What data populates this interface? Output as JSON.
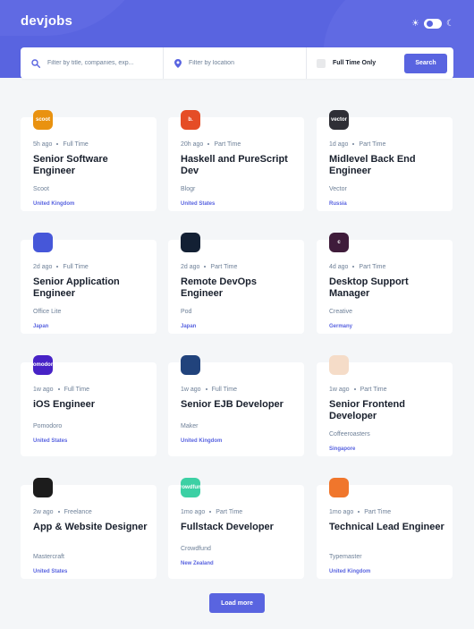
{
  "app": {
    "logo": "devjobs"
  },
  "theme": {
    "sun_icon": "sun-icon",
    "moon_icon": "moon-icon",
    "mode": "light"
  },
  "filters": {
    "title_placeholder": "Filter by title, companies, exp...",
    "location_placeholder": "Filter by location",
    "full_time_label": "Full Time Only",
    "search_label": "Search"
  },
  "colors": {
    "accent": "#5964e0",
    "background": "#f4f6f8",
    "text": "#19202d",
    "muted": "#6e8098"
  },
  "jobs": [
    {
      "posted": "5h ago",
      "contract": "Full Time",
      "position": "Senior Software Engineer",
      "company": "Scoot",
      "location": "United Kingdom",
      "logo_text": "scoot",
      "logo_color": "#e99210"
    },
    {
      "posted": "20h ago",
      "contract": "Part Time",
      "position": "Haskell and PureScript Dev",
      "company": "Blogr",
      "location": "United States",
      "logo_text": "b.",
      "logo_color": "#e54d26"
    },
    {
      "posted": "1d ago",
      "contract": "Part Time",
      "position": "Midlevel Back End Engineer",
      "company": "Vector",
      "location": "Russia",
      "logo_text": "vector",
      "logo_color": "#2f2f36"
    },
    {
      "posted": "2d ago",
      "contract": "Full Time",
      "position": "Senior Application Engineer",
      "company": "Office Lite",
      "location": "Japan",
      "logo_text": "",
      "logo_color": "#4657d9"
    },
    {
      "posted": "2d ago",
      "contract": "Part Time",
      "position": "Remote DevOps Engineer",
      "company": "Pod",
      "location": "Japan",
      "logo_text": "",
      "logo_color": "#132034"
    },
    {
      "posted": "4d ago",
      "contract": "Part Time",
      "position": "Desktop Support Manager",
      "company": "Creative",
      "location": "Germany",
      "logo_text": "c",
      "logo_color": "#3f1c3b"
    },
    {
      "posted": "1w ago",
      "contract": "Full Time",
      "position": "iOS Engineer",
      "company": "Pomodoro",
      "location": "United States",
      "logo_text": "pomodoro",
      "logo_color": "#4722c6"
    },
    {
      "posted": "1w ago",
      "contract": "Full Time",
      "position": "Senior EJB Developer",
      "company": "Maker",
      "location": "United Kingdom",
      "logo_text": "",
      "logo_color": "#21437c"
    },
    {
      "posted": "1w ago",
      "contract": "Part Time",
      "position": "Senior Frontend Developer",
      "company": "Coffeeroasters",
      "location": "Singapore",
      "logo_text": "",
      "logo_color": "#f5dcc8"
    },
    {
      "posted": "2w ago",
      "contract": "Freelance",
      "position": "App & Website Designer",
      "company": "Mastercraft",
      "location": "United States",
      "logo_text": "",
      "logo_color": "#1c1c1c"
    },
    {
      "posted": "1mo ago",
      "contract": "Part Time",
      "position": "Fullstack Developer",
      "company": "Crowdfund",
      "location": "New Zealand",
      "logo_text": "crowdfund",
      "logo_color": "#3cd0a4"
    },
    {
      "posted": "1mo ago",
      "contract": "Part Time",
      "position": "Technical Lead Engineer",
      "company": "Typemaster",
      "location": "United Kingdom",
      "logo_text": "",
      "logo_color": "#f0762c"
    }
  ],
  "load_more_label": "Load more"
}
